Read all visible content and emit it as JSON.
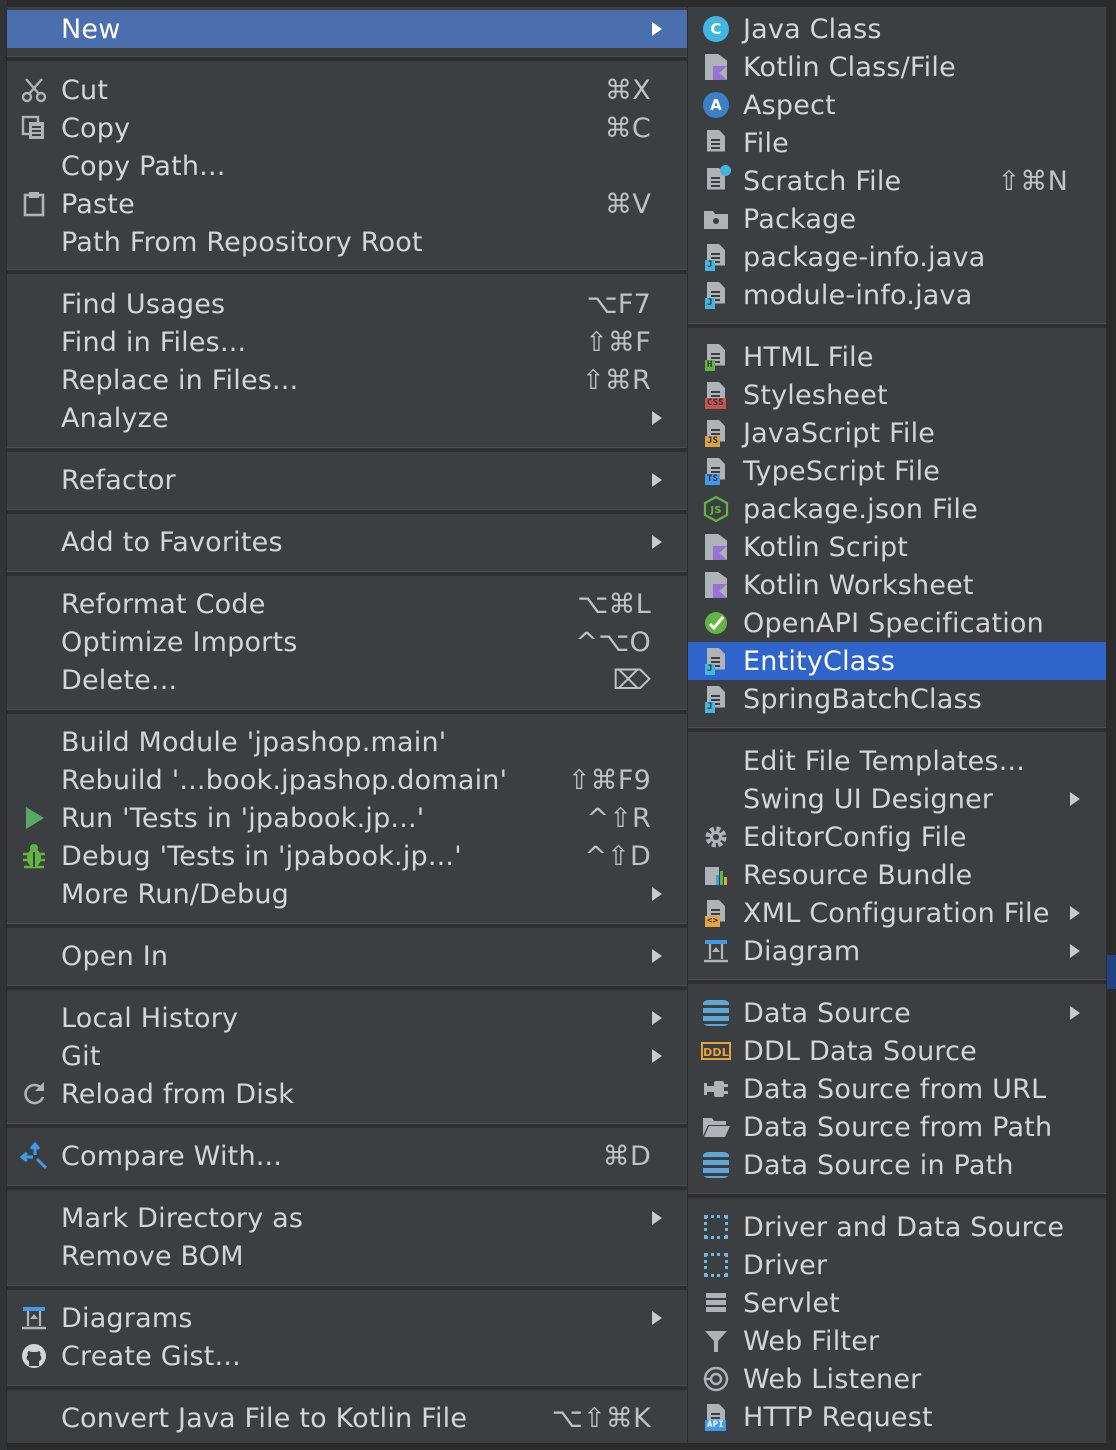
{
  "main_menu": {
    "items": [
      {
        "label": "New",
        "shortcut": "",
        "submenu": true,
        "icon": ""
      },
      {
        "label": "Cut",
        "shortcut": "⌘X",
        "submenu": false,
        "icon": "scissors-icon"
      },
      {
        "label": "Copy",
        "shortcut": "⌘C",
        "submenu": false,
        "icon": "copy-icon"
      },
      {
        "label": "Copy Path...",
        "shortcut": "",
        "submenu": false,
        "icon": ""
      },
      {
        "label": "Paste",
        "shortcut": "⌘V",
        "submenu": false,
        "icon": "clipboard-icon"
      },
      {
        "label": "Path From Repository Root",
        "shortcut": "",
        "submenu": false,
        "icon": ""
      },
      {
        "label": "Find Usages",
        "shortcut": "⌥F7",
        "submenu": false,
        "icon": ""
      },
      {
        "label": "Find in Files...",
        "shortcut": "⇧⌘F",
        "submenu": false,
        "icon": ""
      },
      {
        "label": "Replace in Files...",
        "shortcut": "⇧⌘R",
        "submenu": false,
        "icon": ""
      },
      {
        "label": "Analyze",
        "shortcut": "",
        "submenu": true,
        "icon": ""
      },
      {
        "label": "Refactor",
        "shortcut": "",
        "submenu": true,
        "icon": ""
      },
      {
        "label": "Add to Favorites",
        "shortcut": "",
        "submenu": true,
        "icon": ""
      },
      {
        "label": "Reformat Code",
        "shortcut": "⌥⌘L",
        "submenu": false,
        "icon": ""
      },
      {
        "label": "Optimize Imports",
        "shortcut": "^⌥O",
        "submenu": false,
        "icon": ""
      },
      {
        "label": "Delete...",
        "shortcut": "⌦",
        "submenu": false,
        "icon": ""
      },
      {
        "label": "Build Module 'jpashop.main'",
        "shortcut": "",
        "submenu": false,
        "icon": ""
      },
      {
        "label": "Rebuild '...book.jpashop.domain'",
        "shortcut": "⇧⌘F9",
        "submenu": false,
        "icon": ""
      },
      {
        "label": "Run 'Tests in 'jpabook.jp...'",
        "shortcut": "^⇧R",
        "submenu": false,
        "icon": "run-icon"
      },
      {
        "label": "Debug 'Tests in 'jpabook.jp...'",
        "shortcut": "^⇧D",
        "submenu": false,
        "icon": "debug-bug-icon"
      },
      {
        "label": "More Run/Debug",
        "shortcut": "",
        "submenu": true,
        "icon": ""
      },
      {
        "label": "Open In",
        "shortcut": "",
        "submenu": true,
        "icon": ""
      },
      {
        "label": "Local History",
        "shortcut": "",
        "submenu": true,
        "icon": ""
      },
      {
        "label": "Git",
        "shortcut": "",
        "submenu": true,
        "icon": ""
      },
      {
        "label": "Reload from Disk",
        "shortcut": "",
        "submenu": false,
        "icon": "reload-icon"
      },
      {
        "label": "Compare With...",
        "shortcut": "⌘D",
        "submenu": false,
        "icon": "compare-arrows-icon"
      },
      {
        "label": "Mark Directory as",
        "shortcut": "",
        "submenu": true,
        "icon": ""
      },
      {
        "label": "Remove BOM",
        "shortcut": "",
        "submenu": false,
        "icon": ""
      },
      {
        "label": "Diagrams",
        "shortcut": "",
        "submenu": true,
        "icon": "diagram-icon"
      },
      {
        "label": "Create Gist...",
        "shortcut": "",
        "submenu": false,
        "icon": "github-icon"
      },
      {
        "label": "Convert Java File to Kotlin File",
        "shortcut": "⌥⇧⌘K",
        "submenu": false,
        "icon": ""
      }
    ]
  },
  "sub_menu": {
    "items": [
      {
        "label": "Java Class",
        "shortcut": "",
        "submenu": false,
        "icon": "java-class-icon"
      },
      {
        "label": "Kotlin Class/File",
        "shortcut": "",
        "submenu": false,
        "icon": "kotlin-file-icon"
      },
      {
        "label": "Aspect",
        "shortcut": "",
        "submenu": false,
        "icon": "aspect-icon"
      },
      {
        "label": "File",
        "shortcut": "",
        "submenu": false,
        "icon": "file-icon"
      },
      {
        "label": "Scratch File",
        "shortcut": "⇧⌘N",
        "submenu": false,
        "icon": "scratch-file-icon"
      },
      {
        "label": "Package",
        "shortcut": "",
        "submenu": false,
        "icon": "package-folder-icon"
      },
      {
        "label": "package-info.java",
        "shortcut": "",
        "submenu": false,
        "icon": "java-file-icon"
      },
      {
        "label": "module-info.java",
        "shortcut": "",
        "submenu": false,
        "icon": "java-file-icon"
      },
      {
        "label": "HTML File",
        "shortcut": "",
        "submenu": false,
        "icon": "html-file-icon"
      },
      {
        "label": "Stylesheet",
        "shortcut": "",
        "submenu": false,
        "icon": "css-file-icon"
      },
      {
        "label": "JavaScript File",
        "shortcut": "",
        "submenu": false,
        "icon": "js-file-icon"
      },
      {
        "label": "TypeScript File",
        "shortcut": "",
        "submenu": false,
        "icon": "ts-file-icon"
      },
      {
        "label": "package.json File",
        "shortcut": "",
        "submenu": false,
        "icon": "nodejs-icon"
      },
      {
        "label": "Kotlin Script",
        "shortcut": "",
        "submenu": false,
        "icon": "kotlin-script-icon"
      },
      {
        "label": "Kotlin Worksheet",
        "shortcut": "",
        "submenu": false,
        "icon": "kotlin-worksheet-icon"
      },
      {
        "label": "OpenAPI Specification",
        "shortcut": "",
        "submenu": false,
        "icon": "openapi-icon"
      },
      {
        "label": "EntityClass",
        "shortcut": "",
        "submenu": false,
        "icon": "java-file-icon"
      },
      {
        "label": "SpringBatchClass",
        "shortcut": "",
        "submenu": false,
        "icon": "java-file-icon"
      },
      {
        "label": "Edit File Templates...",
        "shortcut": "",
        "submenu": false,
        "icon": ""
      },
      {
        "label": "Swing UI Designer",
        "shortcut": "",
        "submenu": true,
        "icon": ""
      },
      {
        "label": "EditorConfig File",
        "shortcut": "",
        "submenu": false,
        "icon": "gear-icon"
      },
      {
        "label": "Resource Bundle",
        "shortcut": "",
        "submenu": false,
        "icon": "resource-bundle-icon"
      },
      {
        "label": "XML Configuration File",
        "shortcut": "",
        "submenu": true,
        "icon": "xml-file-icon"
      },
      {
        "label": "Diagram",
        "shortcut": "",
        "submenu": true,
        "icon": "diagram-icon"
      },
      {
        "label": "Data Source",
        "shortcut": "",
        "submenu": true,
        "icon": "database-icon"
      },
      {
        "label": "DDL Data Source",
        "shortcut": "",
        "submenu": false,
        "icon": "ddl-icon"
      },
      {
        "label": "Data Source from URL",
        "shortcut": "",
        "submenu": false,
        "icon": "plug-icon"
      },
      {
        "label": "Data Source from Path",
        "shortcut": "",
        "submenu": false,
        "icon": "folder-open-icon"
      },
      {
        "label": "Data Source in Path",
        "shortcut": "",
        "submenu": false,
        "icon": "database-icon"
      },
      {
        "label": "Driver and Data Source",
        "shortcut": "",
        "submenu": false,
        "icon": "driver-chip-icon"
      },
      {
        "label": "Driver",
        "shortcut": "",
        "submenu": false,
        "icon": "driver-chip-icon"
      },
      {
        "label": "Servlet",
        "shortcut": "",
        "submenu": false,
        "icon": "servlet-icon"
      },
      {
        "label": "Web Filter",
        "shortcut": "",
        "submenu": false,
        "icon": "funnel-icon"
      },
      {
        "label": "Web Listener",
        "shortcut": "",
        "submenu": false,
        "icon": "web-listener-icon"
      },
      {
        "label": "HTTP Request",
        "shortcut": "",
        "submenu": false,
        "icon": "http-api-icon"
      }
    ]
  },
  "colors": {
    "menu_bg": "#3c3f41",
    "selection": "#4b6eaf",
    "submenu_selection": "#2f65ca",
    "text": "#d4d5d7",
    "separator": "#2c2e30",
    "run_green": "#59a869",
    "debug_green": "#62b543",
    "java_blue": "#40b6e0",
    "kotlin_purple": "#9872d9"
  }
}
